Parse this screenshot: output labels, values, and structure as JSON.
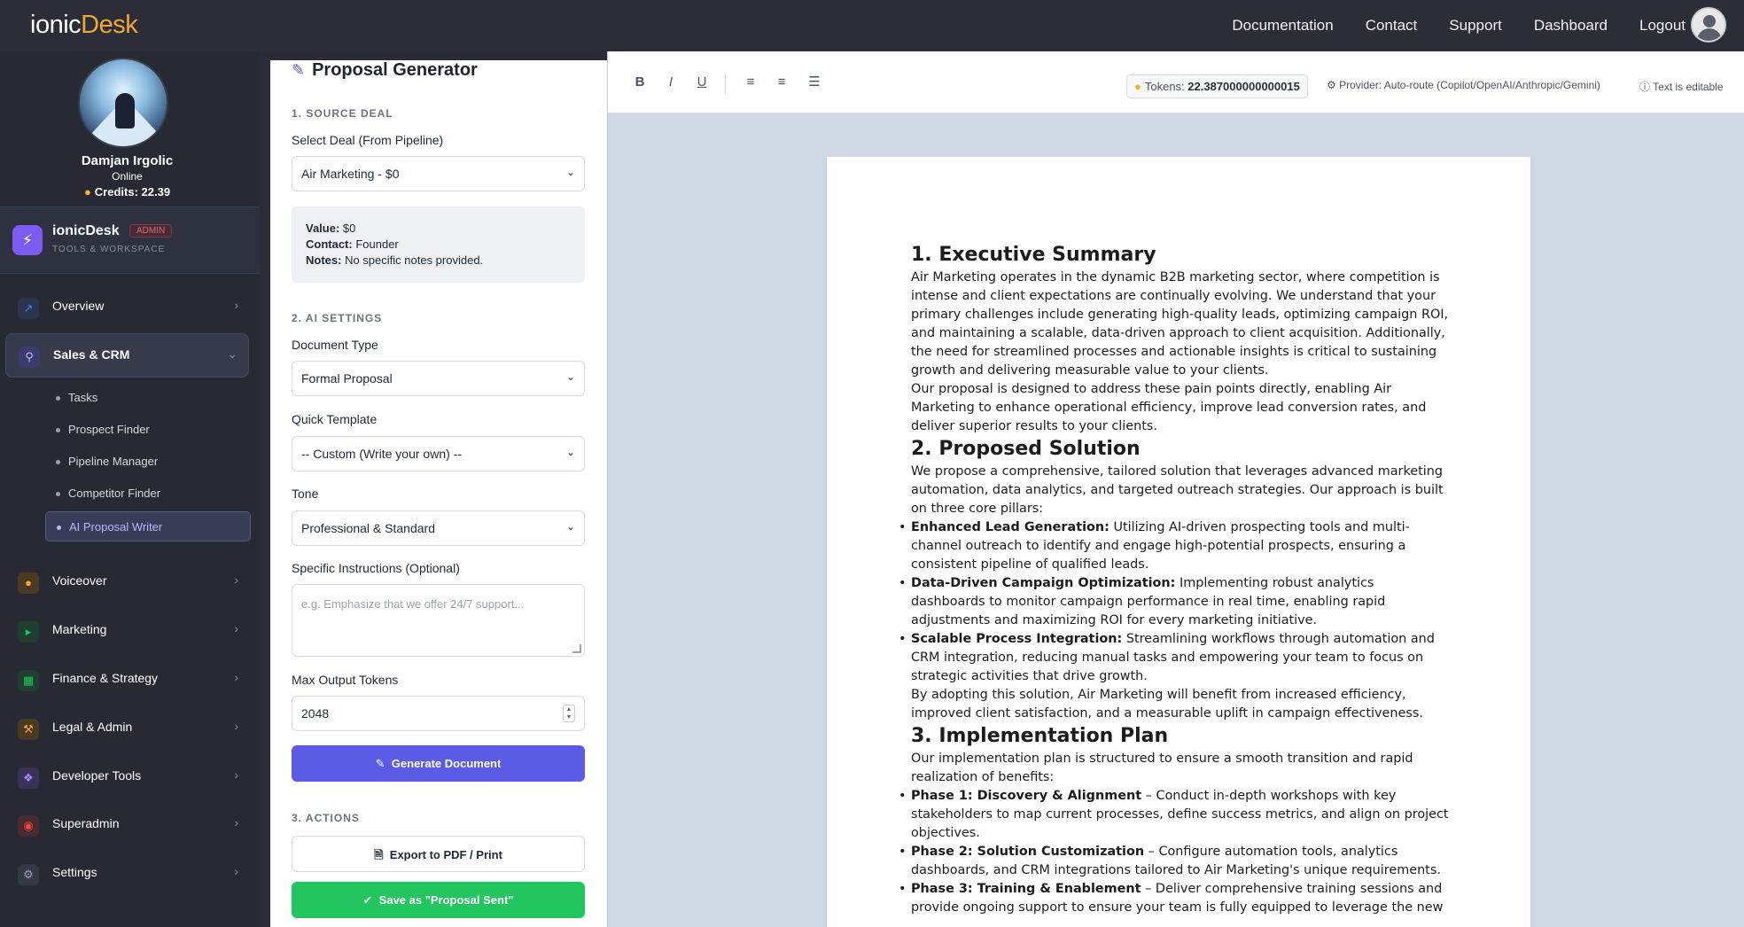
{
  "header": {
    "brand_main": "ionic",
    "brand_accent": "Desk",
    "nav": [
      "Documentation",
      "Contact",
      "Support",
      "Dashboard",
      "Logout"
    ]
  },
  "profile": {
    "name": "Damjan Irgolic",
    "status": "Online",
    "credits": "Credits: 22.39"
  },
  "app": {
    "name": "ionicDesk",
    "badge": "ADMIN",
    "subtitle": "TOOLS & WORKSPACE"
  },
  "sidebar": {
    "items": [
      {
        "label": "Overview",
        "icon": "chart-line-icon",
        "color": "#3b82f6"
      },
      {
        "label": "Sales & CRM",
        "icon": "search-icon",
        "color": "#7c5cf0"
      },
      {
        "label": "Voiceover",
        "icon": "microphone-icon",
        "color": "#f0a832"
      },
      {
        "label": "Marketing",
        "icon": "megaphone-icon",
        "color": "#22c55e"
      },
      {
        "label": "Finance & Strategy",
        "icon": "calculator-icon",
        "color": "#22c55e"
      },
      {
        "label": "Legal & Admin",
        "icon": "gavel-icon",
        "color": "#f0a832"
      },
      {
        "label": "Developer Tools",
        "icon": "code-icon",
        "color": "#a78bfa"
      },
      {
        "label": "Superadmin",
        "icon": "user-shield-icon",
        "color": "#ef4444"
      },
      {
        "label": "Settings",
        "icon": "gear-icon",
        "color": "#9ca3af"
      }
    ],
    "sub_items": [
      "Tasks",
      "Prospect Finder",
      "Pipeline Manager",
      "Competitor Finder",
      "AI Proposal Writer"
    ]
  },
  "panel": {
    "title": "Proposal Generator",
    "section1": "1. SOURCE DEAL",
    "deal_label": "Select Deal (From Pipeline)",
    "deal_value": "Air Marketing - $0",
    "info": {
      "value_label": "Value:",
      "value": "$0",
      "contact_label": "Contact:",
      "contact": "Founder",
      "notes_label": "Notes:",
      "notes": "No specific notes provided."
    },
    "section2": "2. AI SETTINGS",
    "doc_type_label": "Document Type",
    "doc_type_value": "Formal Proposal",
    "template_label": "Quick Template",
    "template_value": "-- Custom (Write your own) --",
    "tone_label": "Tone",
    "tone_value": "Professional & Standard",
    "instructions_label": "Specific Instructions (Optional)",
    "instructions_placeholder": "e.g. Emphasize that we offer 24/7 support...",
    "max_tokens_label": "Max Output Tokens",
    "max_tokens_value": "2048",
    "generate_label": "Generate Document",
    "section3": "3. ACTIONS",
    "export_label": "Export to PDF / Print",
    "save_label": "Save as \"Proposal Sent\""
  },
  "toolbar": {
    "tokens_label": "Tokens:",
    "tokens_value": "22.387000000000015",
    "provider": "Provider: Auto-route (Copilot/OpenAI/Anthropic/Gemini)",
    "editable": "Text is editable"
  },
  "document": {
    "h1": "1. Executive Summary",
    "p1": "Air Marketing operates in the dynamic B2B marketing sector, where competition is intense and client expectations are continually evolving. We understand that your primary challenges include generating high-quality leads, optimizing campaign ROI, and maintaining a scalable, data-driven approach to client acquisition. Additionally, the need for streamlined processes and actionable insights is critical to sustaining growth and delivering measurable value to your clients.",
    "p2": "Our proposal is designed to address these pain points directly, enabling Air Marketing to enhance operational efficiency, improve lead conversion rates, and deliver superior results to your clients.",
    "h2": "2. Proposed Solution",
    "p3": "We propose a comprehensive, tailored solution that leverages advanced marketing automation, data analytics, and targeted outreach strategies. Our approach is built on three core pillars:",
    "b1_title": "Enhanced Lead Generation:",
    "b1_text": " Utilizing AI-driven prospecting tools and multi-channel outreach to identify and engage high-potential prospects, ensuring a consistent pipeline of qualified leads.",
    "b2_title": "Data-Driven Campaign Optimization:",
    "b2_text": " Implementing robust analytics dashboards to monitor campaign performance in real time, enabling rapid adjustments and maximizing ROI for every marketing initiative.",
    "b3_title": "Scalable Process Integration:",
    "b3_text": " Streamlining workflows through automation and CRM integration, reducing manual tasks and empowering your team to focus on strategic activities that drive growth.",
    "p4": "By adopting this solution, Air Marketing will benefit from increased efficiency, improved client satisfaction, and a measurable uplift in campaign effectiveness.",
    "h3": "3. Implementation Plan",
    "p5": "Our implementation plan is structured to ensure a smooth transition and rapid realization of benefits:",
    "c1_title": "Phase 1: Discovery & Alignment",
    "c1_text": " – Conduct in-depth workshops with key stakeholders to map current processes, define success metrics, and align on project objectives.",
    "c2_title": "Phase 2: Solution Customization",
    "c2_text": " – Configure automation tools, analytics dashboards, and CRM integrations tailored to Air Marketing's unique requirements.",
    "c3_title": "Phase 3: Training & Enablement",
    "c3_text": " – Deliver comprehensive training sessions and provide ongoing support to ensure your team is fully equipped to leverage the new"
  }
}
